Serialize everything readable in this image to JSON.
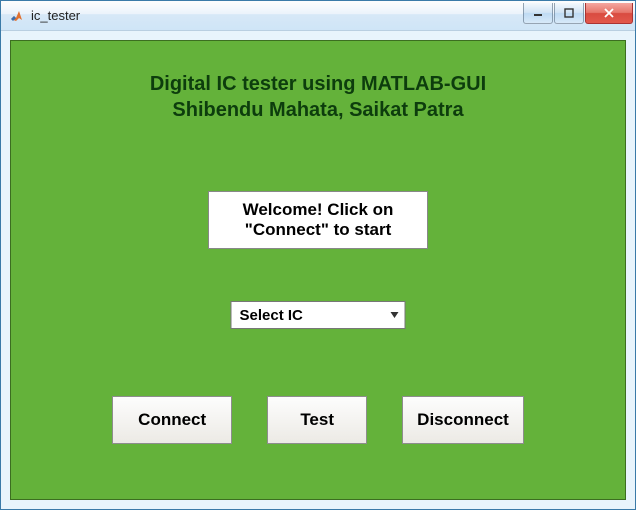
{
  "window": {
    "title": "ic_tester"
  },
  "heading": {
    "line1": "Digital IC tester using MATLAB-GUI",
    "line2": "Shibendu Mahata, Saikat Patra"
  },
  "message": "Welcome! Click on\n\"Connect\" to start",
  "dropdown": {
    "selected": "Select IC"
  },
  "buttons": {
    "connect": "Connect",
    "test": "Test",
    "disconnect": "Disconnect"
  },
  "colors": {
    "panel": "#64b23a",
    "heading": "#0d3d0d"
  }
}
